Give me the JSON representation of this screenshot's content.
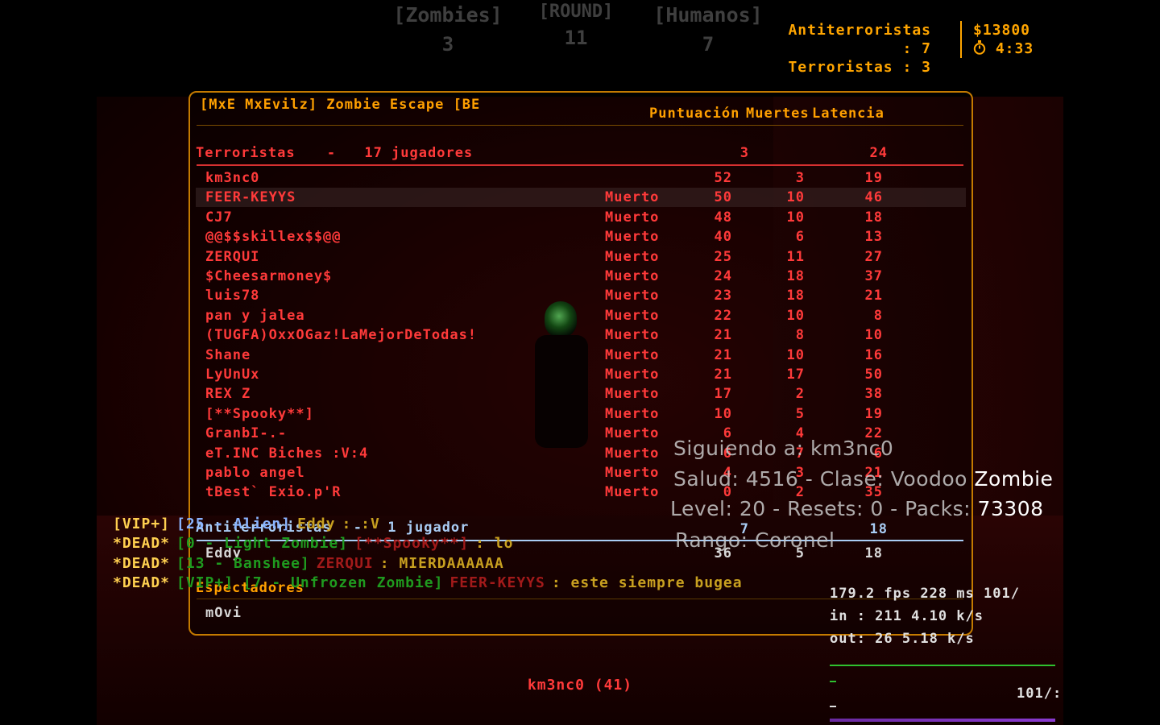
{
  "top_hud": {
    "zombies_label": "[Zombies]",
    "zombies_count": "3",
    "round_label": "[ROUND]",
    "round_number": "11",
    "humans_label": "[Humanos]",
    "humans_count": "7",
    "ct_line": "Antiterroristas : 7",
    "t_line": "Terroristas : 3",
    "money": "$13800",
    "timer": "4:33",
    "timer_icon": "stopwatch-icon"
  },
  "scoreboard": {
    "server_title": "[MxE MxEvilz] Zombie Escape [BE",
    "headers": {
      "score": "Puntuación",
      "deaths": "Muertes",
      "latency": "Latencia"
    },
    "terrorists": {
      "label": "Terroristas",
      "dash": "-",
      "count": "17 jugadores",
      "score": "3",
      "latency": "24",
      "players": [
        {
          "name": "km3nc0",
          "status": "",
          "score": "52",
          "deaths": "3",
          "latency": "19"
        },
        {
          "name": "FEER-KEYYS",
          "status": "Muerto",
          "score": "50",
          "deaths": "10",
          "latency": "46"
        },
        {
          "name": "CJ7",
          "status": "Muerto",
          "score": "48",
          "deaths": "10",
          "latency": "18"
        },
        {
          "name": "@@$$skillex$$@@",
          "status": "Muerto",
          "score": "40",
          "deaths": "6",
          "latency": "13"
        },
        {
          "name": "ZERQUI",
          "status": "Muerto",
          "score": "25",
          "deaths": "11",
          "latency": "27"
        },
        {
          "name": "$Cheesarmoney$",
          "status": "Muerto",
          "score": "24",
          "deaths": "18",
          "latency": "37"
        },
        {
          "name": "luis78",
          "status": "Muerto",
          "score": "23",
          "deaths": "18",
          "latency": "21"
        },
        {
          "name": "pan y jalea",
          "status": "Muerto",
          "score": "22",
          "deaths": "10",
          "latency": "8"
        },
        {
          "name": "(TUGFA)OxxOGaz!LaMejorDeTodas!",
          "status": "Muerto",
          "score": "21",
          "deaths": "8",
          "latency": "10"
        },
        {
          "name": "Shane",
          "status": "Muerto",
          "score": "21",
          "deaths": "10",
          "latency": "16"
        },
        {
          "name": "LyUnUx",
          "status": "Muerto",
          "score": "21",
          "deaths": "17",
          "latency": "50"
        },
        {
          "name": "REX Z",
          "status": "Muerto",
          "score": "17",
          "deaths": "2",
          "latency": "38"
        },
        {
          "name": "[**Spooky**]",
          "status": "Muerto",
          "score": "10",
          "deaths": "5",
          "latency": "19"
        },
        {
          "name": "GranbI-.-",
          "status": "Muerto",
          "score": "6",
          "deaths": "4",
          "latency": "22"
        },
        {
          "name": "eT.INC Biches :V:4",
          "status": "Muerto",
          "score": "6",
          "deaths": "7",
          "latency": "6"
        },
        {
          "name": "pablo angel",
          "status": "Muerto",
          "score": "4",
          "deaths": "3",
          "latency": "21"
        },
        {
          "name": "tBest` Exio.p'R",
          "status": "Muerto",
          "score": "0",
          "deaths": "2",
          "latency": "35"
        }
      ]
    },
    "counter_terrorists": {
      "label": "Antiterroristas",
      "dash": "-",
      "count": "1 jugador",
      "score": "7",
      "latency": "18",
      "players": [
        {
          "name": "Eddy",
          "status": "",
          "score": "36",
          "deaths": "5",
          "latency": "18"
        }
      ]
    },
    "spectators": {
      "label": "Espectadores",
      "players": [
        {
          "name": "mOvi"
        }
      ]
    }
  },
  "chat": [
    {
      "prefix": "[VIP+]",
      "tag": "[25 - Alien]",
      "name": "Eddy",
      "msg": ": :V"
    },
    {
      "prefix": "*DEAD*",
      "tag": "[0 - Light Zombie]",
      "name": "[**Spooky**]",
      "msg": ": lo"
    },
    {
      "prefix": "*DEAD*",
      "tag": "[13 - Banshee]",
      "name": "ZERQUI",
      "msg": ": MIERDAAAAAA"
    },
    {
      "prefix": "*DEAD*",
      "tag": "[VIP+] [7 - Unfrozen Zombie]",
      "name": "FEER-KEYYS",
      "msg": ": este siempre bugea"
    }
  ],
  "spectator_info": {
    "following": "Siguiendo a: km3nc0",
    "health_prefix": "Salud: 4516 - Clase: Voodoo",
    "health_class_highlight": "Zombie",
    "level_prefix": "Level: 20 - Resets: 0 - Packs:",
    "packs_value": "73308",
    "rank": "Rango: Coronel"
  },
  "netgraph": {
    "fps_line": "179.2 fps    228 ms 101/",
    "in_line": "in :  211 4.10 k/s",
    "out_line": "out:  26 5.18 k/s",
    "rate_line": "101/:",
    "graph_color": "#2fc02f"
  },
  "bottom_target": "km3nc0 (41)",
  "colors": {
    "hud_orange": "#ffa000",
    "terrorist_red": "#ff3a3a",
    "ct_blue": "#a9cdf5"
  }
}
